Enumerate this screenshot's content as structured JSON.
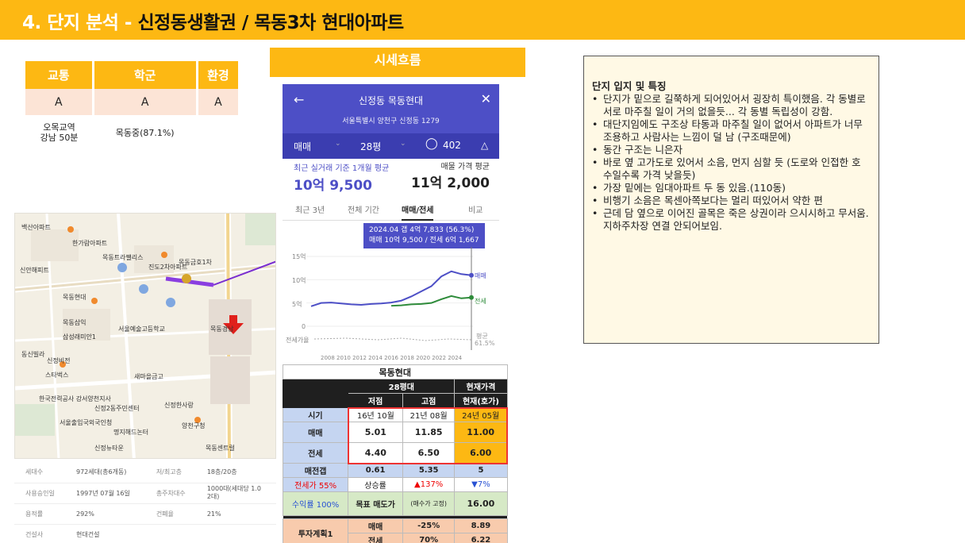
{
  "header": {
    "prefix": "4. 단지 분석 - ",
    "title": "신정동생활권 / 목동3차 현대아파트"
  },
  "rating": {
    "headers": [
      "교통",
      "학군",
      "환경"
    ],
    "grades": [
      "A",
      "A",
      "A"
    ],
    "notes": [
      "오목교역\n강남 50분",
      "목동중(87.1%)",
      ""
    ]
  },
  "map": {
    "labels": [
      "백산아파트",
      "한가람아파트",
      "목동트라팰리스",
      "진도2차아파트",
      "목동금호1차",
      "신안해피트",
      "목동현대",
      "서울예술고등학교",
      "목동삼익",
      "삼성래미안1",
      "동신빌라",
      "목동경남",
      "신정비전",
      "새마을금고",
      "스타벅스",
      "한국전력공사 강서양천지사",
      "서울출입국외국인청",
      "신정2동주민센터",
      "신정한사랑",
      "명지해드논터",
      "목동센트럴",
      "신정뉴타운",
      "양천구청"
    ]
  },
  "building_info": {
    "rows": [
      [
        "세대수",
        "972세대(총6개동)",
        "저/최고층",
        "18층/20층"
      ],
      [
        "사용승인일",
        "1997년 07월 16일",
        "총주차대수",
        "1000대(세대당 1.0\n2대)"
      ],
      [
        "용적률",
        "292%",
        "건폐율",
        "21%"
      ],
      [
        "건설사",
        "현대건설",
        "",
        ""
      ]
    ]
  },
  "trend_banner": "시세흐름",
  "app": {
    "title": "신정동 목동현대",
    "address": "서울특별시 양천구 신정동 1279",
    "filters": [
      "매매",
      "28평",
      "402"
    ],
    "avg_label": "최근 실거래 기준 1개월 평균",
    "avg_value": "10억 9,500",
    "ask_label": "매물 가격 평균",
    "ask_value": "11억 2,000",
    "tabs": [
      "최근 3년",
      "전체 기간",
      "매매/전세",
      "비교"
    ],
    "tooltip_1": "2024.04  갭 4억 7,833 (56.3%)",
    "tooltip_2": "매매 10억 9,500 / 전세 6억 1,667",
    "y_ticks": [
      "15억",
      "10억",
      "5억",
      "0"
    ],
    "series_labels": [
      "매매",
      "전세"
    ],
    "ratio_label": "전세가율",
    "ratio_right": "평균",
    "ratio_value": "61.5%",
    "x_ticks": "2008  2010  2012  2014  2016  2018  2020  2022  2024"
  },
  "chart_data": {
    "type": "line",
    "title": "",
    "x": [
      2008,
      2009,
      2010,
      2011,
      2012,
      2013,
      2014,
      2015,
      2016,
      2017,
      2018,
      2019,
      2020,
      2021,
      2022,
      2023,
      2024
    ],
    "ylim": [
      0,
      15
    ],
    "series": [
      {
        "name": "매매",
        "values": [
          4.3,
          5.0,
          5.1,
          4.9,
          4.7,
          4.6,
          4.8,
          4.9,
          5.1,
          5.5,
          6.4,
          7.5,
          8.6,
          10.7,
          11.8,
          11.2,
          10.95
        ]
      },
      {
        "name": "전세",
        "values": [
          null,
          null,
          null,
          null,
          null,
          null,
          null,
          null,
          4.4,
          4.5,
          4.7,
          4.8,
          5.0,
          5.8,
          6.5,
          6.0,
          6.17
        ]
      }
    ]
  },
  "analysis": {
    "title": "목동현대",
    "size": "28평대",
    "current_price": "현재가격",
    "col_low": "저점",
    "col_high": "고점",
    "col_current": "현재(호가)",
    "rows": {
      "period": [
        "시기",
        "16년 10월",
        "21년 08월",
        "24년 05월"
      ],
      "sale": [
        "매매",
        "5.01",
        "11.85",
        "11.00"
      ],
      "jeonse": [
        "전세",
        "4.40",
        "6.50",
        "6.00"
      ],
      "gap": [
        "매전갭",
        "0.61",
        "5.35",
        "5"
      ],
      "ratio": [
        "전세가 55%",
        "상승률",
        "▲137%",
        "▼7%"
      ],
      "target": [
        "수익률 100%",
        "목표 매도가",
        "(매수가 고정)",
        "16.00"
      ],
      "plan_label": "투자계획1",
      "plan_sale": [
        "매매",
        "-25%",
        "8.89"
      ],
      "plan_jeonse": [
        "전세",
        "70%",
        "6.22"
      ]
    }
  },
  "notes": {
    "title": "단지 입지 및 특징",
    "items": [
      "단지가 밑으로 길쭉하게 되어있어서 굉장히 특이했음. 각 동별로 서로 마주칠 일이 거의 없을듯... 각 동별 독립성이 강함.",
      "대단지임에도 구조상 타동과 마주칠 일이 없어서 아파트가 너무 조용하고 사람사는 느낌이 덜 남 (구조때문에)",
      "동간 구조는 니은자",
      "바로 옆 고가도로 있어서 소음, 먼지 심할 듯 (도로와 인접한 호수일수록 가격 낮을듯)",
      "가장 밑에는 임대아파트 두 동 있음.(110동)",
      "비행기 소음은 목센아쪽보다는 멀리 떠있어서 약한 편",
      "근데 담 옆으로 이어진 골목은 죽은 상권이라 으시시하고 무서움. 지하주차장 연결 안되어보임."
    ]
  }
}
